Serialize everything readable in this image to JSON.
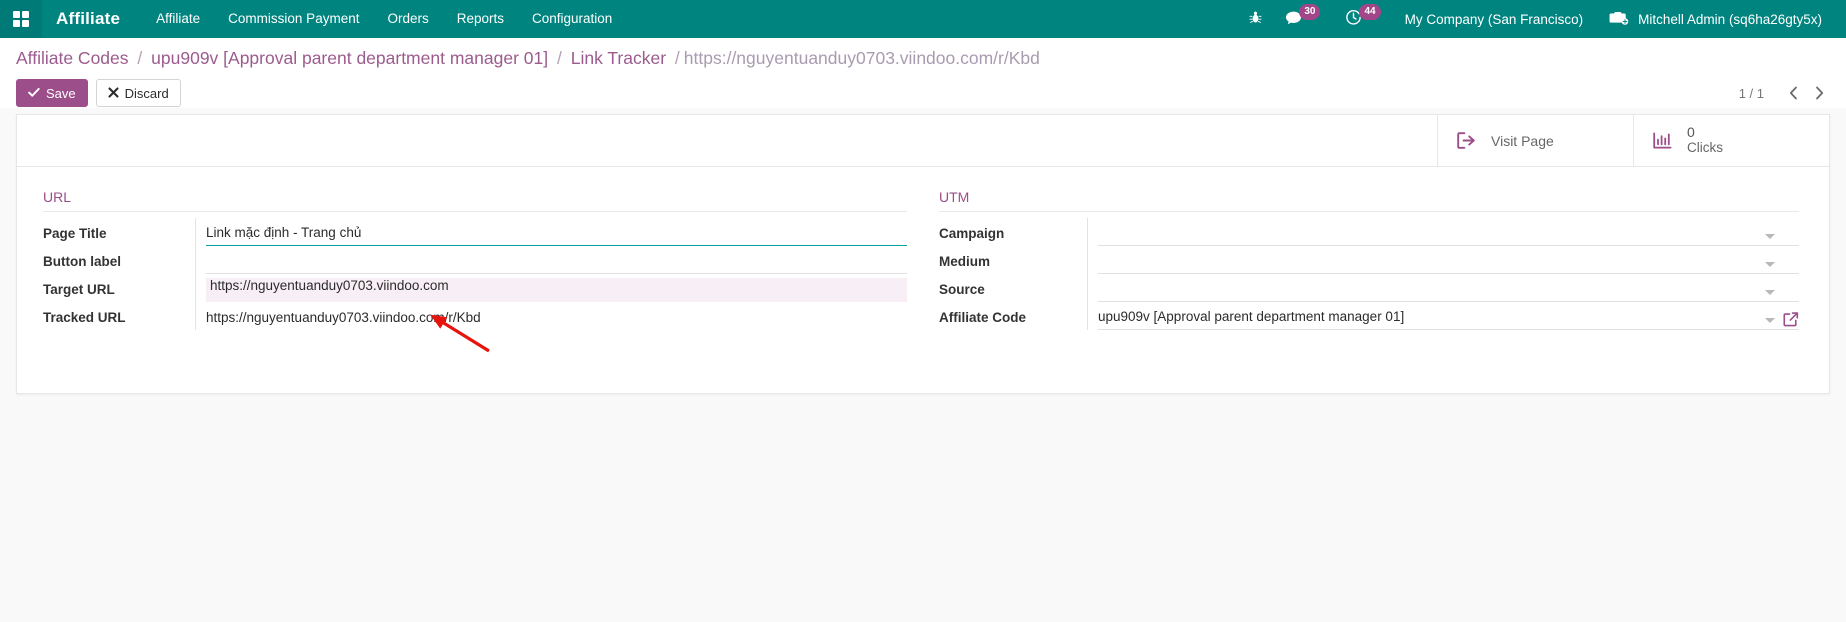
{
  "navbar": {
    "apps_icon": "grid-apps-icon",
    "brand": "Affiliate",
    "menu_items": [
      {
        "label": "Affiliate",
        "name": "affiliate"
      },
      {
        "label": "Commission Payment",
        "name": "commission-payment"
      },
      {
        "label": "Orders",
        "name": "orders"
      },
      {
        "label": "Reports",
        "name": "reports"
      },
      {
        "label": "Configuration",
        "name": "configuration"
      }
    ],
    "systray": {
      "debug_icon": "bug-icon",
      "messaging_icon": "chat-icon",
      "messaging_count": "30",
      "activity_icon": "clock-icon",
      "activity_count": "44",
      "company": "My Company (San Francisco)",
      "user_icon": "camera-add-icon",
      "user": "Mitchell Admin (sq6ha26gty5x)"
    },
    "accent": "#00847F"
  },
  "control_panel": {
    "breadcrumb": {
      "root": "Affiliate Codes",
      "sep": "/",
      "parent": "upu909v [Approval parent department manager 01]",
      "section": "Link Tracker",
      "record": "https://nguyentuanduy0703.viindoo.com/r/Kbd"
    },
    "save_label": "Save",
    "save_icon": "check-icon",
    "discard_label": "Discard",
    "discard_icon": "times-icon",
    "pager": {
      "count": "1 / 1",
      "prev_icon": "chevron-left-icon",
      "next_icon": "chevron-right-icon"
    }
  },
  "sheet": {
    "stat_buttons": [
      {
        "name": "visit-page",
        "icon": "external-arrow-icon",
        "label": "Visit Page",
        "value": ""
      },
      {
        "name": "clicks",
        "icon": "bar-chart-icon",
        "value": "0",
        "label": "Clicks"
      }
    ],
    "left_group": {
      "title": "URL",
      "fields": [
        {
          "name": "page-title",
          "label": "Page Title",
          "value": "Link mặc định - Trang chủ",
          "placeholder": "",
          "type": "input-focused"
        },
        {
          "name": "button-label",
          "label": "Button label",
          "value": "",
          "placeholder": "",
          "type": "input"
        },
        {
          "name": "target-url",
          "label": "Target URL",
          "value": "https://nguyentuanduy0703.viindoo.com",
          "placeholder": "",
          "type": "readonly-highlight"
        },
        {
          "name": "tracked-url",
          "label": "Tracked URL",
          "value": "https://nguyentuanduy0703.viindoo.com/r/Kbd",
          "placeholder": "",
          "type": "readonly"
        }
      ]
    },
    "right_group": {
      "title": "UTM",
      "fields": [
        {
          "name": "campaign",
          "label": "Campaign",
          "value": "",
          "placeholder": "",
          "type": "many2one"
        },
        {
          "name": "medium",
          "label": "Medium",
          "value": "",
          "placeholder": "",
          "type": "many2one"
        },
        {
          "name": "source",
          "label": "Source",
          "value": "",
          "placeholder": "",
          "type": "many2one"
        },
        {
          "name": "affiliate-code",
          "label": "Affiliate Code",
          "value": "upu909v [Approval parent department manager 01]",
          "placeholder": "",
          "type": "many2one-link"
        }
      ]
    }
  },
  "annotation": {
    "arrow_color": "#E8130C",
    "arrow_name": "red-pointer-arrow"
  }
}
